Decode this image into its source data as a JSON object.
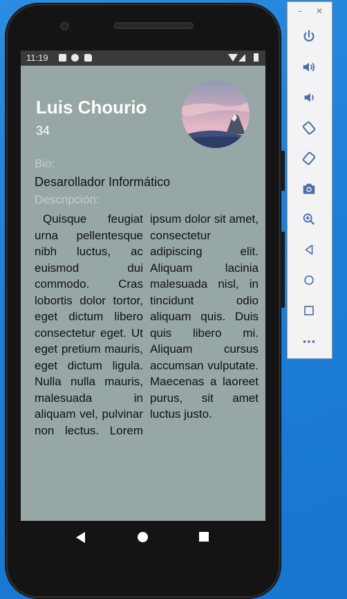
{
  "status_bar": {
    "time": "11:19"
  },
  "profile": {
    "name": "Luis Chourio",
    "age": "34",
    "bio_label": "Bio:",
    "bio": "Desarollador Informático",
    "description_label": "Descripción:",
    "description": "Quisque feugiat urna pellentesque nibh luctus, ac euismod dui commodo. Cras lobortis dolor tortor, eget dictum libero consectetur eget. Ut eget pretium mauris, eget dictum ligula. Nulla nulla mauris, malesuada in aliquam vel, pulvinar non lectus. Lorem ipsum dolor sit amet, consectetur adipiscing elit. Aliquam lacinia malesuada nisl, in tincidunt odio aliquam quis. Duis quis libero mi. Aliquam cursus accumsan vulputate. Maecenas a laoreet purus, sit amet luctus justo."
  },
  "emulator_toolbar": {
    "icons": [
      "power-icon",
      "volume-up-icon",
      "volume-down-icon",
      "rotate-left-icon",
      "rotate-right-icon",
      "camera-icon",
      "zoom-icon",
      "back-icon",
      "home-icon",
      "overview-icon",
      "more-icon"
    ]
  },
  "colors": {
    "screen_background": "#96a7a5",
    "toolbar_icon": "#4a6fa8",
    "desktop": "#1d7fd8"
  }
}
